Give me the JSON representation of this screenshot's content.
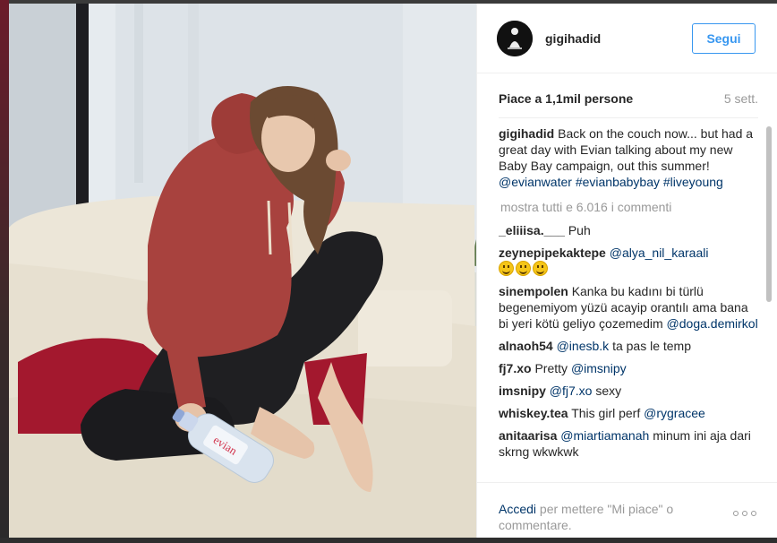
{
  "post": {
    "username": "gigihadid",
    "follow_label": "Segui",
    "likes": "Piace a 1,1mil persone",
    "time_ago": "5 sett.",
    "caption": {
      "user": "gigihadid",
      "text": "Back on the couch now... but had a great day with Evian talking about my new Baby Bay campaign, out this summer!",
      "tags": [
        "@evianwater",
        "#evianbabybay",
        "#liveyoung"
      ]
    },
    "show_all_comments": "mostra tutti e 6.016 i commenti",
    "comments": [
      {
        "user": "_eliiisa.___",
        "text": "Puh"
      },
      {
        "user": "zeynepipekaktepe",
        "mention": "@alya_nil_karaali",
        "emoji_count": 3
      },
      {
        "user": "sinempolen",
        "text": "Kanka bu kadını bi türlü begenemiyom yüzü acayip orantılı ama bana bi yeri kötü geliyo çozemedim",
        "mention": "@doga.demirkol"
      },
      {
        "user": "alnaoh54",
        "mention": "@inesb.k",
        "text": "ta pas le temp"
      },
      {
        "user": "fj7.xo",
        "text": "Pretty",
        "mention": "@imsnipy"
      },
      {
        "user": "imsnipy",
        "mention": "@fj7.xo",
        "text": "sexy"
      },
      {
        "user": "whiskey.tea",
        "text": "This girl perf",
        "mention": "@rygracee"
      },
      {
        "user": "anitaarisa",
        "mention": "@miartiamanah",
        "text": "minum ini aja dari skrng wkwkwk"
      }
    ],
    "footer": {
      "login_link": "Accedi",
      "login_text": "per mettere \"Mi piace\" o commentare."
    },
    "photo": {
      "bottle_label": "evian"
    }
  }
}
